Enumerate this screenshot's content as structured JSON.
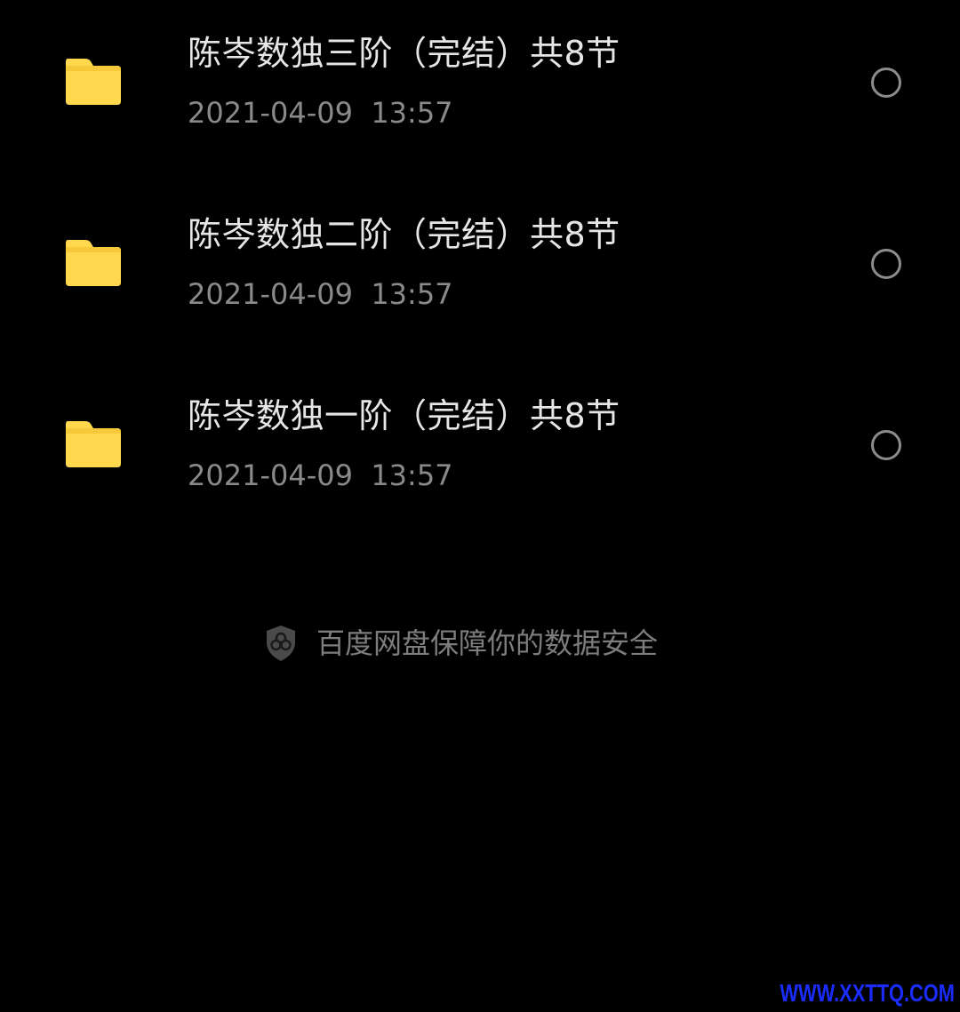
{
  "files": [
    {
      "name": "陈岑数独三阶（完结）共8节",
      "date": "2021-04-09  13:57",
      "icon": "folder-icon",
      "selected": false
    },
    {
      "name": "陈岑数独二阶（完结）共8节",
      "date": "2021-04-09  13:57",
      "icon": "folder-icon",
      "selected": false
    },
    {
      "name": "陈岑数独一阶（完结）共8节",
      "date": "2021-04-09  13:57",
      "icon": "folder-icon",
      "selected": false
    }
  ],
  "footer": {
    "icon": "shield-icon",
    "text": "百度网盘保障你的数据安全"
  },
  "watermark": {
    "text": "WWW.XXTTQ.COM"
  },
  "colors": {
    "background": "#000000",
    "folder": "#FFD84D",
    "title_text": "#e6e6e6",
    "date_text": "#8a8a8a",
    "radio_border": "#8c8c8c",
    "footer_text": "#7d7d7d",
    "watermark": "#1a2cff"
  }
}
